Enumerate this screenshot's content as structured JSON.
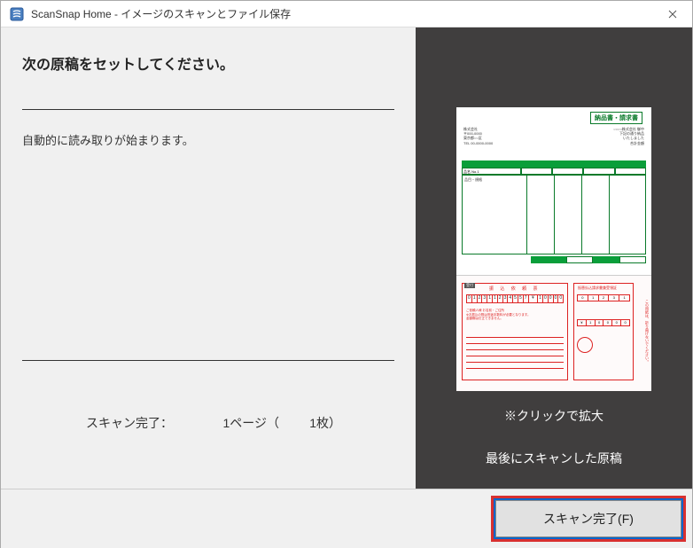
{
  "titlebar": {
    "title": "ScanSnap Home - イメージのスキャンとファイル保存"
  },
  "left": {
    "heading": "次の原稿をセットしてください。",
    "subtext": "自動的に読み取りが始まります。",
    "status_label": "スキャン完了：",
    "pages_value": "1",
    "pages_unit": "ページ（",
    "sheets_value": "1",
    "sheets_unit": "枚）"
  },
  "right": {
    "click_hint": "※クリックで拡大",
    "last_scan_label": "最後にスキャンした原稿",
    "preview_doc": {
      "top_title": "納品書・請求書",
      "nums_left": [
        "0",
        "1",
        "2",
        "3",
        "1",
        "1",
        "2",
        "3",
        "4",
        "5",
        "5",
        "7"
      ],
      "amount": [
        "¥",
        "1",
        "0",
        "0",
        "0",
        "0"
      ],
      "nums_right1": [
        "0",
        "1",
        "2",
        "3",
        "1"
      ],
      "nums_right2": [
        "¥",
        "1",
        "0",
        "0",
        "0",
        "0"
      ]
    }
  },
  "footer": {
    "finish_label": "スキャン完了(F)"
  },
  "colors": {
    "dark_panel": "#403e3e",
    "light_panel": "#f0f0f0",
    "highlight_border": "#d83030",
    "focus_border": "#0066cc",
    "doc_green": "#0a9e3a",
    "doc_red": "#d22"
  }
}
